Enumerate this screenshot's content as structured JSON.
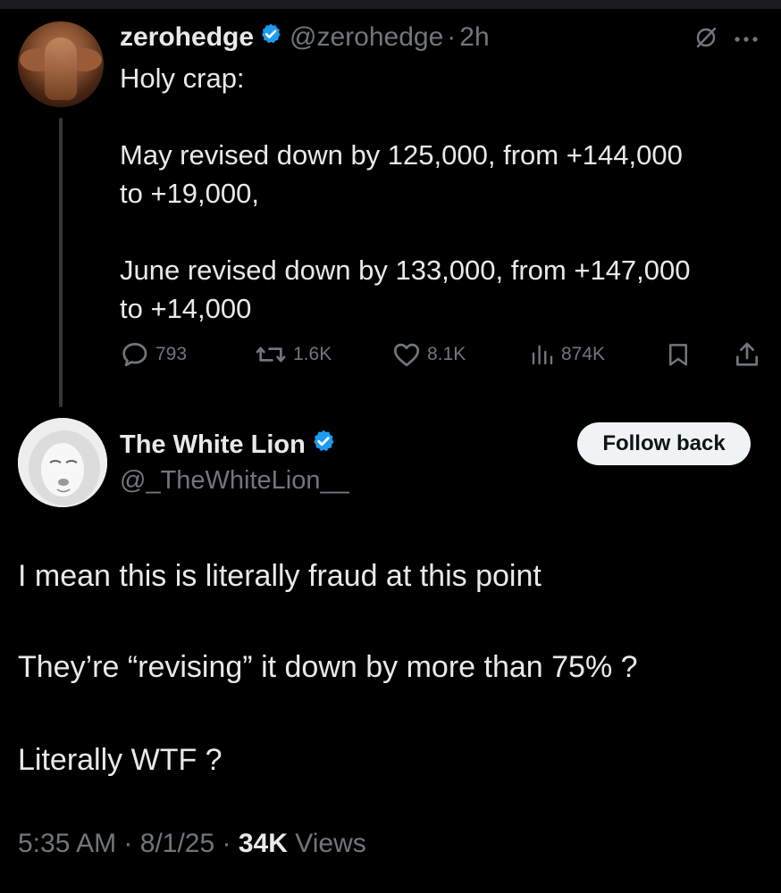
{
  "tweet": {
    "author": {
      "display_name": "zerohedge",
      "handle": "@zerohedge",
      "verified": true,
      "avatar_icon": "avatar-photo"
    },
    "sep": "·",
    "time": "2h",
    "text_lines": [
      "Holy crap:",
      "May revised down by 125,000, from +144,000",
      "to +19,000,",
      "June revised down by 133,000, from +147,000",
      "to +14,000"
    ],
    "stats": {
      "replies": "793",
      "reposts": "1.6K",
      "likes": "8.1K",
      "views": "874K"
    }
  },
  "reply": {
    "author": {
      "display_name": "The White Lion",
      "handle": "@_TheWhiteLion__",
      "verified": true,
      "avatar_icon": "white-lion-avatar"
    },
    "follow_label": "Follow back",
    "text_lines": [
      "I mean this is literally fraud at this point",
      "They’re “revising” it down by more than 75% ?",
      "Literally WTF ?"
    ],
    "meta": {
      "time": "5:35 AM",
      "sep1": "·",
      "date": "8/1/25",
      "sep2": "·",
      "views_count": "34K",
      "views_label": "Views"
    }
  },
  "colors": {
    "background": "#000000",
    "text": "#e7e9ea",
    "muted": "#71767b",
    "verified_blue": "#1d9bf0",
    "follow_button_bg": "#eff3f4"
  }
}
